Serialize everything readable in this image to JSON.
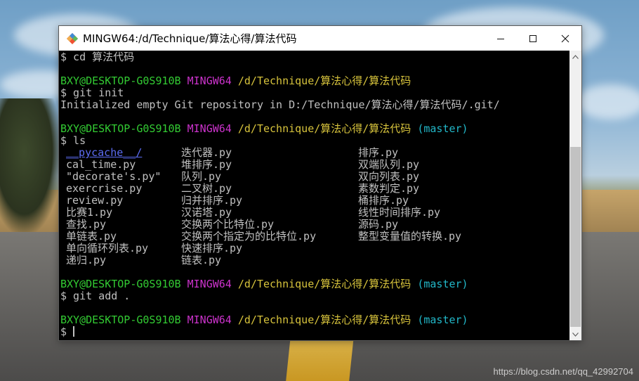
{
  "window": {
    "title": "MINGW64:/d/Technique/算法心得/算法代码",
    "app_icon": "git-bash-icon",
    "controls": [
      "minimize-icon",
      "maximize-icon",
      "close-icon"
    ]
  },
  "terminal": {
    "cmd_cd": "$ cd 算法代码",
    "prompt_user": "BXY@DESKTOP-G0S910B",
    "prompt_shell": "MINGW64",
    "prompt_path": "/d/Technique/算法心得/算法代码",
    "prompt_branch": "(master)",
    "cmd_git_init": "$ git init",
    "init_output": "Initialized empty Git repository in D:/Technique/算法心得/算法代码/.git/",
    "cmd_ls": "$ ls",
    "ls_rows": [
      [
        "__pycache__/",
        "迭代器.py",
        "排序.py"
      ],
      [
        "cal_time.py",
        "堆排序.py",
        "双端队列.py"
      ],
      [
        "\"decorate's.py\"",
        "队列.py",
        "双向列表.py"
      ],
      [
        "exercrise.py",
        "二叉树.py",
        "素数判定.py"
      ],
      [
        "review.py",
        "归并排序.py",
        "桶排序.py"
      ],
      [
        "比赛1.py",
        "汉诺塔.py",
        "线性时间排序.py"
      ],
      [
        "查找.py",
        "交换两个比特位.py",
        "源码.py"
      ],
      [
        "单链表.py",
        "交换两个指定为的比特位.py",
        "整型变量值的转换.py"
      ],
      [
        "单向循环列表.py",
        "快速排序.py",
        ""
      ],
      [
        "递归.py",
        "链表.py",
        ""
      ]
    ],
    "cmd_git_add": "$ git add .",
    "final_prompt_symbol": "$"
  },
  "desktop": {
    "watermark": "https://blog.csdn.net/qq_42992704"
  },
  "colors": {
    "terminal_bg": "#000000",
    "user_green": "#33cc33",
    "shell_magenta": "#cc33cc",
    "path_yellow": "#d7c33c",
    "branch_cyan": "#22b8c9",
    "dir_blue": "#5c6cf2"
  }
}
